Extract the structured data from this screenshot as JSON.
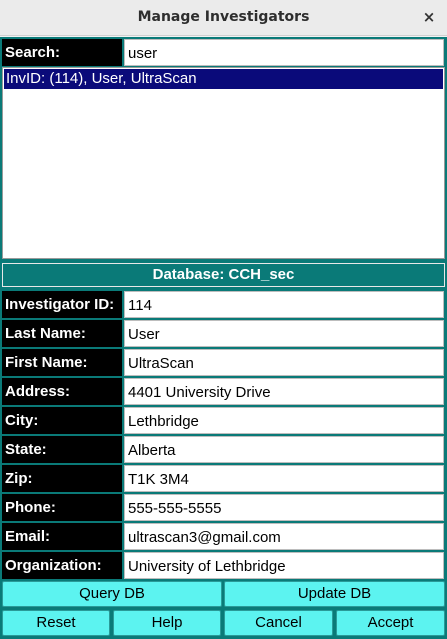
{
  "window": {
    "title": "Manage Investigators",
    "close_glyph": "×"
  },
  "search": {
    "label": "Search:",
    "value": "user"
  },
  "results": [
    "InvID: (114), User, UltraScan"
  ],
  "database": "Database: CCH_sec",
  "fields": [
    {
      "key": "investigator_id",
      "label": "Investigator ID:",
      "value": "114"
    },
    {
      "key": "last_name",
      "label": "Last Name:",
      "value": "User"
    },
    {
      "key": "first_name",
      "label": "First Name:",
      "value": "UltraScan"
    },
    {
      "key": "address",
      "label": "Address:",
      "value": "4401 University Drive"
    },
    {
      "key": "city",
      "label": "City:",
      "value": "Lethbridge"
    },
    {
      "key": "state",
      "label": "State:",
      "value": "Alberta"
    },
    {
      "key": "zip",
      "label": "Zip:",
      "value": "T1K 3M4"
    },
    {
      "key": "phone",
      "label": "Phone:",
      "value": "555-555-5555"
    },
    {
      "key": "email",
      "label": "Email:",
      "value": "ultrascan3@gmail.com"
    },
    {
      "key": "organization",
      "label": "Organization:",
      "value": "University of Lethbridge"
    }
  ],
  "buttons": {
    "query_db": "Query DB",
    "update_db": "Update DB",
    "reset": "Reset",
    "help": "Help",
    "cancel": "Cancel",
    "accept": "Accept"
  },
  "colors": {
    "panel_teal": "#0a7a78",
    "label_black": "#000000",
    "button_cyan": "#5cf3f0",
    "selection_navy": "#0a0a7a"
  },
  "icons": {
    "close": "close-icon"
  }
}
